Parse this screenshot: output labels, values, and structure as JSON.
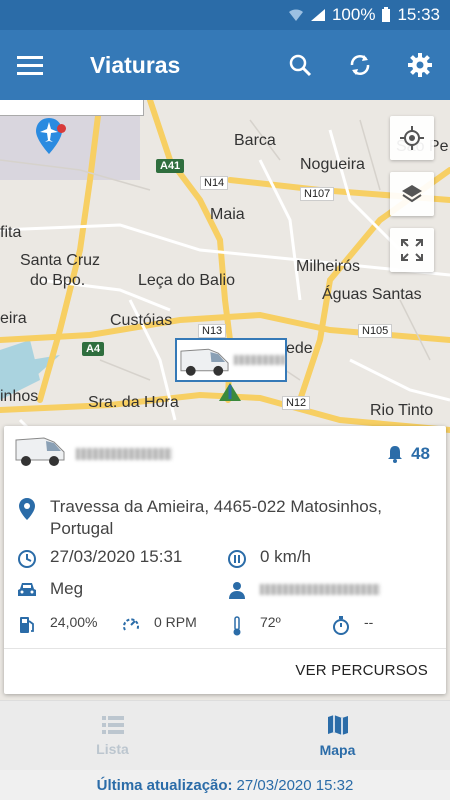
{
  "status_bar": {
    "battery": "100%",
    "time": "15:33"
  },
  "app_bar": {
    "title": "Viaturas"
  },
  "map": {
    "labels": {
      "barca": "Barca",
      "nogueira": "Nogueira",
      "sao_pedro": "São Pe",
      "maia": "Maia",
      "fita": "fita",
      "santa_cruz": "Santa Cruz",
      "do_bpo": "do Bpo.",
      "leca_do_balio": "Leça do Balio",
      "milheiros": "Milheirós",
      "aguas_santas": "Águas Santas",
      "custoias": "Custóias",
      "eira": "eira",
      "sra_da_hora": "Sra. da Hora",
      "rio_tinto": "Rio Tinto",
      "inhos": "inhos",
      "ede": "ede"
    },
    "roads": {
      "a41": "A41",
      "a4": "A4",
      "n14": "N14",
      "n107": "N107",
      "n13": "N13",
      "n105": "N105",
      "n12": "N12"
    }
  },
  "card": {
    "alert_count": "48",
    "address": "Travessa da Amieira, 4465-022 Matosinhos, Portugal",
    "datetime": "27/03/2020 15:31",
    "speed": "0 km/h",
    "vehicle_type": "Meg",
    "fuel": "24,00%",
    "rpm": "0 RPM",
    "temperature": "72º",
    "timer": "--",
    "ver_percursos": "VER PERCURSOS"
  },
  "bottom_nav": {
    "lista": "Lista",
    "mapa": "Mapa"
  },
  "footer": {
    "last_update_label": "Última atualização:",
    "last_update_value": "27/03/2020 15:32"
  },
  "colors": {
    "primary": "#3579b7",
    "status_bar": "#2b6ca8",
    "road_major": "#f7cf63"
  }
}
